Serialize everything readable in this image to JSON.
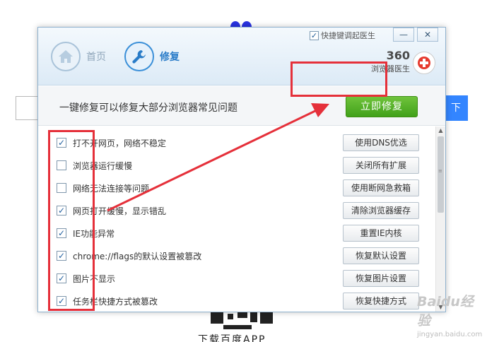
{
  "background": {
    "search_button_label": "下",
    "download_text": "下载百度APP"
  },
  "dialog": {
    "shortcut_label": "快捷键调起医生",
    "shortcut_checked": true,
    "minimize_label": "—",
    "close_label": "✕",
    "tabs": [
      {
        "label": "首页",
        "icon": "home-icon",
        "active": false
      },
      {
        "label": "修复",
        "icon": "wrench-icon",
        "active": true
      }
    ],
    "brand": {
      "number": "360",
      "name": "浏览器医生"
    },
    "action": {
      "title": "一键修复可以修复大部分浏览器常见问题",
      "fix_button": "立即修复"
    },
    "issues": [
      {
        "label": "打不开网页，网络不稳定",
        "checked": true,
        "action": "使用DNS优选"
      },
      {
        "label": "浏览器运行缓慢",
        "checked": false,
        "action": "关闭所有扩展"
      },
      {
        "label": "网络无法连接等问题",
        "checked": false,
        "action": "使用断网急救箱"
      },
      {
        "label": "网页打开缓慢，显示错乱",
        "checked": true,
        "action": "清除浏览器缓存"
      },
      {
        "label": "IE功能异常",
        "checked": true,
        "action": "重置IE内核"
      },
      {
        "label": "chrome://flags的默认设置被篡改",
        "checked": true,
        "action": "恢复默认设置"
      },
      {
        "label": "图片不显示",
        "checked": true,
        "action": "恢复图片设置"
      },
      {
        "label": "任务栏快捷方式被篡改",
        "checked": true,
        "action": "恢复快捷方式"
      }
    ],
    "check_mark": "✓"
  },
  "colors": {
    "accent_blue": "#2a7cc8",
    "fix_green": "#41a11a",
    "annotation_red": "#e5303a"
  },
  "watermark": {
    "main": "Baidu经验",
    "sub": "jingyan.baidu.com"
  }
}
